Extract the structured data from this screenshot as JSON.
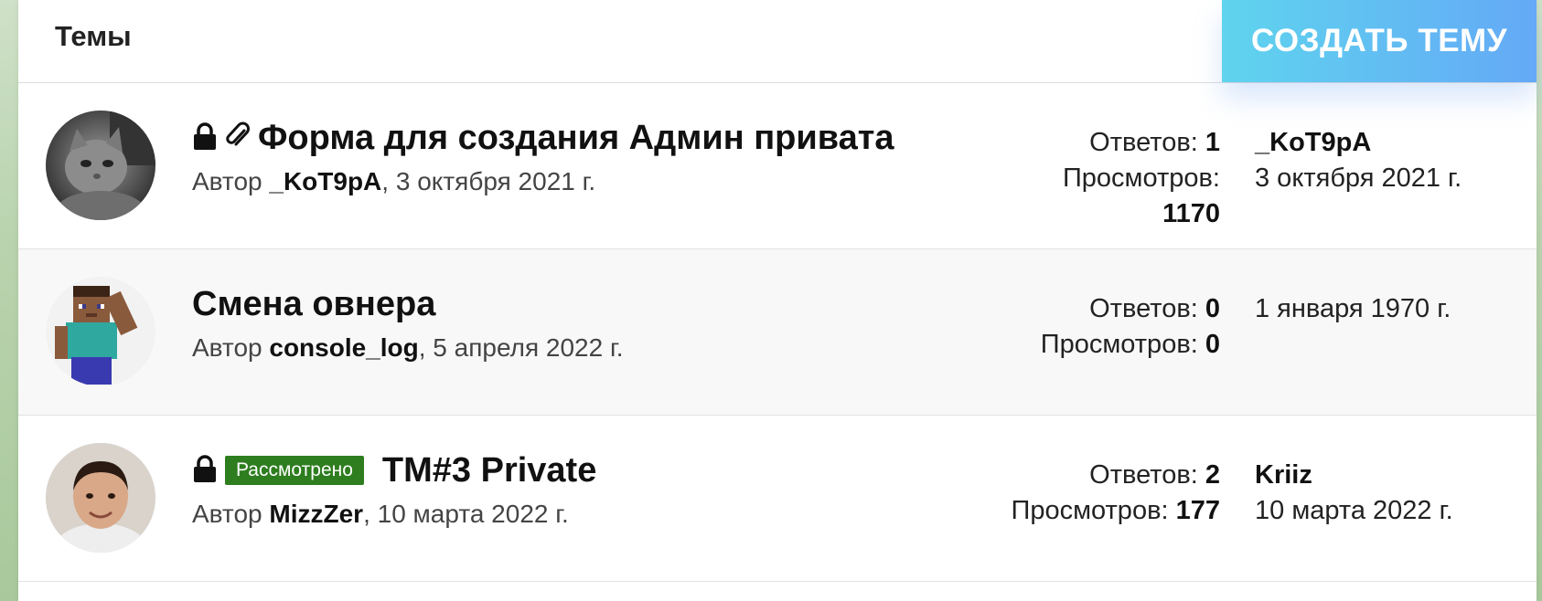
{
  "header": {
    "title": "Темы",
    "create_button": "СОЗДАТЬ ТЕМУ"
  },
  "threads": [
    {
      "title": "Форма для создания Админ привата",
      "icons": [
        "lock-icon",
        "paperclip-icon"
      ],
      "author_prefix": "Автор ",
      "author": "_KoT9pA",
      "date": ", 3 октября 2021 г.",
      "replies_label": "Ответов:",
      "replies": "1",
      "views_label": "Просмотров:",
      "views": "1170",
      "last_user": "_KoT9pA",
      "last_date": "3 октября 2021 г."
    },
    {
      "title": "Смена овнера",
      "icons": [],
      "author_prefix": "Автор ",
      "author": "console_log",
      "date": ", 5 апреля 2022 г.",
      "replies_label": "Ответов:",
      "replies": "0",
      "views_label": "Просмотров:",
      "views": "0",
      "last_user": "",
      "last_date": "1 января 1970 г."
    },
    {
      "title": "TM#3 Private",
      "icons": [
        "lock-icon"
      ],
      "badge": "Рассмотрено",
      "badge_color": "#2e7d1f",
      "author_prefix": "Автор ",
      "author": "MizzZer",
      "date": ", 10 марта 2022 г.",
      "replies_label": "Ответов:",
      "replies": "2",
      "views_label": "Просмотров:",
      "views": "177",
      "last_user": "Kriiz",
      "last_date": "10 марта 2022 г."
    }
  ],
  "colors": {
    "button_gradient_start": "#5fd4ee",
    "button_gradient_end": "#64a9f6",
    "badge": "#2e7d1f"
  }
}
